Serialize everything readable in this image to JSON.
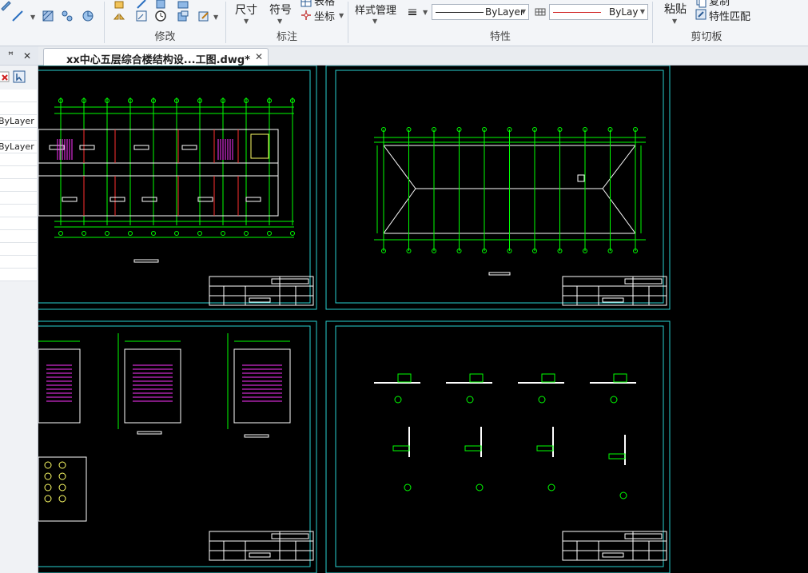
{
  "ribbon": {
    "groups": {
      "modify": "修改",
      "annotate": "标注",
      "properties": "特性",
      "clipboard": "剪切板"
    },
    "dimension_label": "尺寸",
    "symbol_label": "符号",
    "table_label": "表格",
    "coordinate_label": "坐标",
    "style_manager_label": "样式管理",
    "linetype_value": "ByLayer",
    "color_value": "ByLayer",
    "paste_label": "粘贴",
    "copy_label": "复制",
    "match_props_label": "特性匹配"
  },
  "left_panel": {
    "pin_label": "f",
    "close_label": "✕",
    "rows": [
      "",
      "",
      "ByLayer",
      "",
      "ByLayer",
      "",
      "",
      "",
      "",
      "",
      "",
      "",
      "",
      "",
      ""
    ]
  },
  "tabs": [
    {
      "label": "xx中心五层综合楼结构设...工图.dwg*",
      "close": "✕"
    }
  ],
  "colors": {
    "sheet_border": "#27d0d0",
    "drawing_line": "#00ff00",
    "wall_line": "#ffffff",
    "stair_line": "#ff33ff",
    "axis_red": "#ff3030"
  },
  "icons": [
    "pencil-icon",
    "line-icon",
    "rotate-icon",
    "offset-icon",
    "trim-icon",
    "copy-icon",
    "paste-icon",
    "match-properties-icon",
    "table-icon",
    "coordinate-icon",
    "lineweight-icon"
  ]
}
